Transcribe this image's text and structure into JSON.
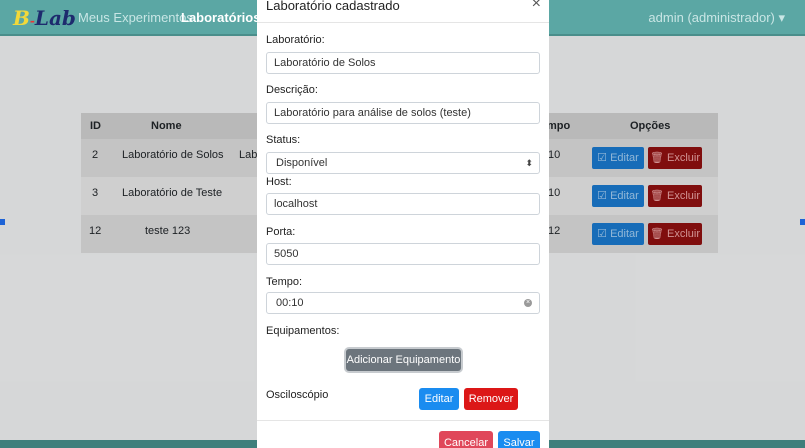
{
  "nav": {
    "brand_b": "B",
    "brand_lab": "Lab",
    "link_experiments": "Meus Experimentos",
    "link_labs": "Laboratórios",
    "admin": "admin (administrador) ▾"
  },
  "table": {
    "headers": [
      "ID",
      "Nome",
      "mpo",
      "Opções"
    ],
    "rows": [
      {
        "id": "2",
        "name": "Laboratório de Solos",
        "desc": "Labo",
        "tempo": "10"
      },
      {
        "id": "3",
        "name": "Laboratório de Teste",
        "desc": "",
        "tempo": "10"
      },
      {
        "id": "12",
        "name": "teste 123",
        "desc": "",
        "tempo": "12"
      }
    ],
    "edit_label": "Editar",
    "delete_label": "Excluir"
  },
  "modal": {
    "title": "Laboratório cadastrado",
    "close": "×",
    "lab_label": "Laboratório:",
    "lab_value": "Laboratório de Solos",
    "desc_label": "Descrição:",
    "desc_value": "Laboratório para análise de solos (teste)",
    "status_label": "Status:",
    "status_value": "Disponível",
    "host_label": "Host:",
    "host_value": "localhost",
    "port_label": "Porta:",
    "port_value": "5050",
    "time_label": "Tempo:",
    "time_value": "00:10",
    "equip_label": "Equipamentos:",
    "add_equip": "Adicionar Equipamento",
    "equip_name": "Osciloscópio",
    "edit_equip": "Editar",
    "remove_equip": "Remover",
    "cancel": "Cancelar",
    "save": "Salvar"
  },
  "colors": {
    "navbar": "#5ba7a4",
    "primary": "#1a8cf0",
    "danger": "#dc1717"
  }
}
